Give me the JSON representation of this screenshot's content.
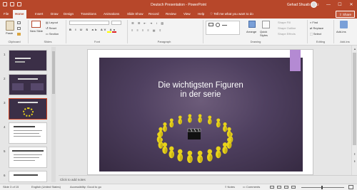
{
  "window": {
    "title": "Deutsch Presentation  -  PowerPoint",
    "user": "Gehad Shuaib"
  },
  "tabs": [
    "File",
    "Home",
    "Insert",
    "Draw",
    "Design",
    "Transitions",
    "Animations",
    "Slide Show",
    "Record",
    "Review",
    "View",
    "Help"
  ],
  "active_tab": "Home",
  "tell_me": "Tell me what you want to do",
  "share_label": "Share",
  "ribbon": {
    "paste": "Paste",
    "new_slide": "New Slide",
    "layout": "Layout",
    "reset": "Reset",
    "section": "Section",
    "arrange": "Arrange",
    "quick_styles": "Quick Styles",
    "shape_fill": "Shape Fill",
    "shape_outline": "Shape Outline",
    "shape_effects": "Shape Effects",
    "find": "Find",
    "replace": "Replace",
    "select": "Select",
    "addins": "Add-ins",
    "groups": {
      "clipboard": "Clipboard",
      "slides": "Slides",
      "font": "Font",
      "paragraph": "Paragraph",
      "drawing": "Drawing",
      "editing": "Editing",
      "addins": "Add-ins"
    }
  },
  "thumbnails": [
    {
      "num": "1",
      "theme": "dark",
      "selected": false
    },
    {
      "num": "2",
      "theme": "dark",
      "selected": false
    },
    {
      "num": "3",
      "theme": "dark",
      "selected": true
    },
    {
      "num": "4",
      "theme": "light",
      "selected": false
    },
    {
      "num": "5",
      "theme": "light",
      "selected": false
    },
    {
      "num": "6",
      "theme": "light",
      "selected": false
    }
  ],
  "slide": {
    "title_line1": "Die wichtigsten Figuren",
    "title_line2": "in der serie",
    "accent": "#b48ad3"
  },
  "notes_placeholder": "Click to add notes",
  "status": {
    "slide_info": "Slide 3 of 15",
    "language": "English (United States)",
    "accessibility": "Accessibility: Good to go",
    "notes": "Notes",
    "comments": "Comments"
  },
  "colors": {
    "brand": "#b7472a",
    "figure": "#e7d21b"
  }
}
